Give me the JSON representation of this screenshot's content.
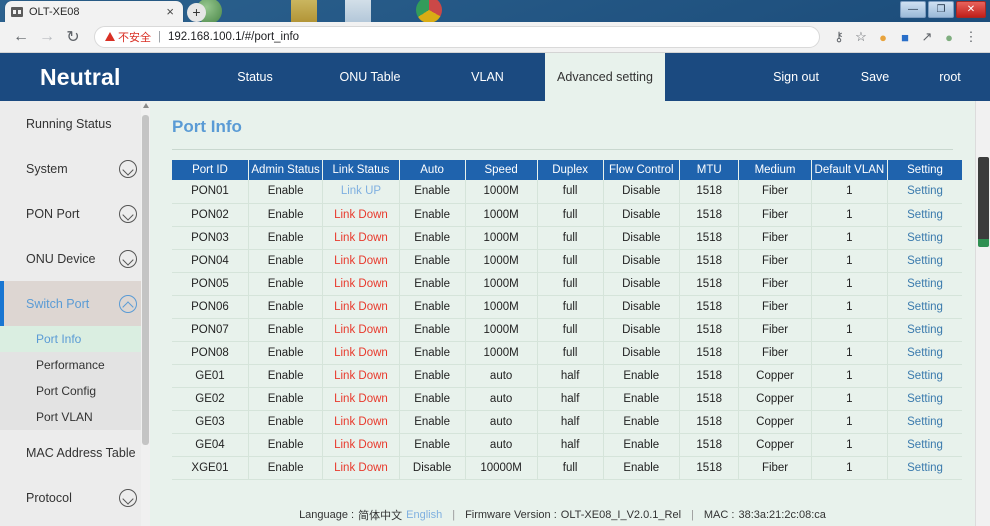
{
  "browser": {
    "tab_title": "OLT-XE08",
    "tab_close": "×",
    "new_tab": "+",
    "back_icon": "←",
    "forward_icon": "→",
    "reload_icon": "↻",
    "security_warning": "不安全",
    "url": "192.168.100.1/#/port_info",
    "separator": "|",
    "icons": {
      "key": "⚷",
      "star": "☆",
      "extension_cookie": "●",
      "extension_doc": "■",
      "extension_share": "↗",
      "profile": "●",
      "menu": "⋮"
    },
    "window": {
      "minimize": "—",
      "maximize": "❐",
      "close": "✕"
    }
  },
  "nav": {
    "brand": "Neutral",
    "items": [
      {
        "label": "Status",
        "active": false
      },
      {
        "label": "ONU Table",
        "active": false
      },
      {
        "label": "VLAN",
        "active": false
      },
      {
        "label": "Advanced setting",
        "active": true
      }
    ],
    "right_items": [
      {
        "label": "Sign out"
      },
      {
        "label": "Save"
      },
      {
        "label": "root"
      }
    ]
  },
  "sidebar": {
    "items": [
      {
        "label": "Running Status",
        "chevron": false,
        "active": false
      },
      {
        "label": "System",
        "chevron": "down",
        "active": false
      },
      {
        "label": "PON Port",
        "chevron": "down",
        "active": false
      },
      {
        "label": "ONU Device",
        "chevron": "down",
        "active": false
      },
      {
        "label": "Switch Port",
        "chevron": "up",
        "active": true
      }
    ],
    "submenu": [
      {
        "label": "Port Info",
        "active": true
      },
      {
        "label": "Performance",
        "active": false
      },
      {
        "label": "Port Config",
        "active": false
      },
      {
        "label": "Port VLAN",
        "active": false
      }
    ],
    "items_after": [
      {
        "label": "MAC Address Table",
        "chevron": false,
        "active": false
      },
      {
        "label": "Protocol",
        "chevron": "down",
        "active": false
      }
    ]
  },
  "main": {
    "title": "Port Info",
    "columns": [
      "Port ID",
      "Admin Status",
      "Link Status",
      "Auto",
      "Speed",
      "Duplex",
      "Flow Control",
      "MTU",
      "Medium",
      "Default VLAN",
      "Setting"
    ],
    "rows": [
      [
        "PON01",
        "Enable",
        "Link UP",
        "Enable",
        "1000M",
        "full",
        "Disable",
        "1518",
        "Fiber",
        "1",
        "Setting"
      ],
      [
        "PON02",
        "Enable",
        "Link Down",
        "Enable",
        "1000M",
        "full",
        "Disable",
        "1518",
        "Fiber",
        "1",
        "Setting"
      ],
      [
        "PON03",
        "Enable",
        "Link Down",
        "Enable",
        "1000M",
        "full",
        "Disable",
        "1518",
        "Fiber",
        "1",
        "Setting"
      ],
      [
        "PON04",
        "Enable",
        "Link Down",
        "Enable",
        "1000M",
        "full",
        "Disable",
        "1518",
        "Fiber",
        "1",
        "Setting"
      ],
      [
        "PON05",
        "Enable",
        "Link Down",
        "Enable",
        "1000M",
        "full",
        "Disable",
        "1518",
        "Fiber",
        "1",
        "Setting"
      ],
      [
        "PON06",
        "Enable",
        "Link Down",
        "Enable",
        "1000M",
        "full",
        "Disable",
        "1518",
        "Fiber",
        "1",
        "Setting"
      ],
      [
        "PON07",
        "Enable",
        "Link Down",
        "Enable",
        "1000M",
        "full",
        "Disable",
        "1518",
        "Fiber",
        "1",
        "Setting"
      ],
      [
        "PON08",
        "Enable",
        "Link Down",
        "Enable",
        "1000M",
        "full",
        "Disable",
        "1518",
        "Fiber",
        "1",
        "Setting"
      ],
      [
        "GE01",
        "Enable",
        "Link Down",
        "Enable",
        "auto",
        "half",
        "Enable",
        "1518",
        "Copper",
        "1",
        "Setting"
      ],
      [
        "GE02",
        "Enable",
        "Link Down",
        "Enable",
        "auto",
        "half",
        "Enable",
        "1518",
        "Copper",
        "1",
        "Setting"
      ],
      [
        "GE03",
        "Enable",
        "Link Down",
        "Enable",
        "auto",
        "half",
        "Enable",
        "1518",
        "Copper",
        "1",
        "Setting"
      ],
      [
        "GE04",
        "Enable",
        "Link Down",
        "Enable",
        "auto",
        "half",
        "Enable",
        "1518",
        "Copper",
        "1",
        "Setting"
      ],
      [
        "XGE01",
        "Enable",
        "Link Down",
        "Disable",
        "10000M",
        "full",
        "Enable",
        "1518",
        "Fiber",
        "1",
        "Setting"
      ]
    ]
  },
  "footer": {
    "language_label": "Language :",
    "language_cn": "简体中文",
    "language_en": "English",
    "sep1": "|",
    "firmware_label": "Firmware Version :",
    "firmware_value": "OLT-XE08_I_V2.0.1_Rel",
    "sep2": "|",
    "mac_label": "MAC :",
    "mac_value": "38:3a:21:2c:08:ca"
  },
  "colors": {
    "nav_blue": "#1b4a80",
    "table_header_blue": "#1f63ad",
    "accent_link": "#5a9bd5",
    "link_down_red": "#e8392c",
    "page_bg": "#e8f2ec"
  }
}
